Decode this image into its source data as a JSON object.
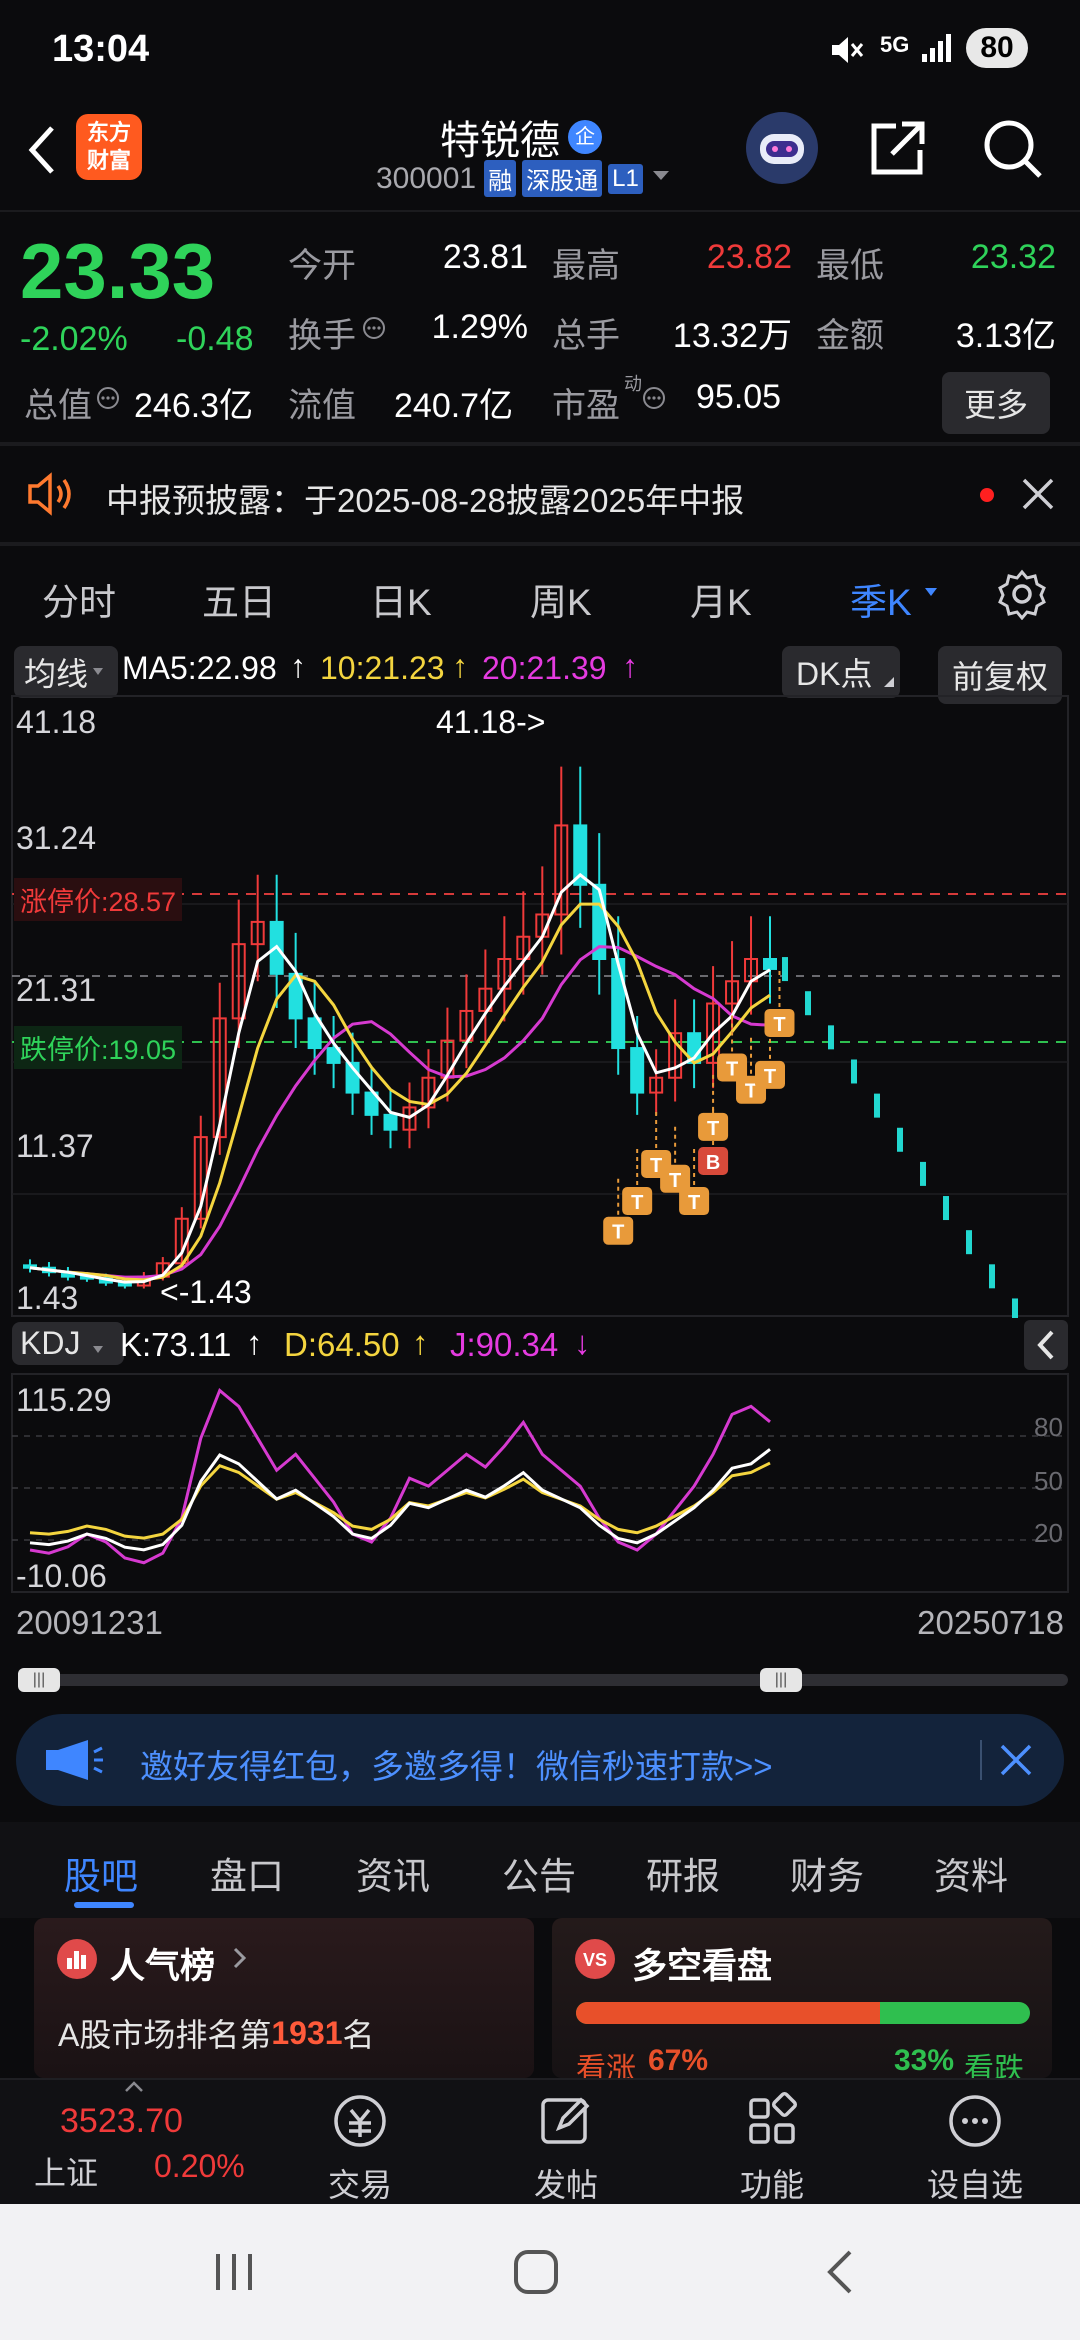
{
  "status_bar": {
    "time": "13:04",
    "network": "5G",
    "battery": "80"
  },
  "header": {
    "app_logo_text": "东方\n财富",
    "stock_name": "特锐德",
    "stock_code": "300001",
    "tags": [
      "融",
      "深股通",
      "L1"
    ],
    "enterprise_badge": "企"
  },
  "quote": {
    "price": "23.33",
    "change_pct": "-2.02%",
    "change_amt": "-0.48",
    "open_label": "今开",
    "open": "23.81",
    "high_label": "最高",
    "high": "23.82",
    "low_label": "最低",
    "low": "23.32",
    "turnover_label": "换手",
    "turnover": "1.29%",
    "volume_label": "总手",
    "volume": "13.32万",
    "amount_label": "金额",
    "amount": "3.13亿",
    "total_mv_label": "总值",
    "total_mv": "246.3亿",
    "float_mv_label": "流值",
    "float_mv": "240.7亿",
    "pe_label": "市盈",
    "pe_sup": "动",
    "pe": "95.05",
    "more_label": "更多"
  },
  "notice": {
    "text": "中报预披露：于2025-08-28披露2025年中报"
  },
  "chart_tabs": {
    "items": [
      "分时",
      "五日",
      "日K",
      "周K",
      "月K",
      "季K"
    ],
    "active": "季K"
  },
  "ma_bar": {
    "selector": "均线",
    "ma5": "MA5:22.98",
    "ma10": "10:21.23",
    "ma20": "20:21.39",
    "dk_label": "DK点",
    "adjust_label": "前复权"
  },
  "price_axis": {
    "top": "41.18",
    "mid1": "31.24",
    "mid2": "21.31",
    "mid3": "11.37",
    "bottom": "1.43"
  },
  "limit_up_label": "涨停价:28.57",
  "limit_down_label": "跌停价:19.05",
  "max_marker": "41.18->",
  "min_marker": "<-1.43",
  "kdj_bar": {
    "selector": "KDJ",
    "k": "K:73.11",
    "d": "D:64.50",
    "j": "J:90.34"
  },
  "kdj_axis": {
    "top": "115.29",
    "bottom": "-10.06",
    "r80": "80",
    "r50": "50",
    "r20": "20"
  },
  "date_range": {
    "start": "20091231",
    "end": "20250718"
  },
  "promo": {
    "text": "邀好友得红包，多邀多得！微信秒速打款>>"
  },
  "section_tabs": {
    "items": [
      "股吧",
      "盘口",
      "资讯",
      "公告",
      "研报",
      "财务",
      "资料"
    ],
    "active": "股吧"
  },
  "popularity_card": {
    "title": "人气榜",
    "rank_prefix": "A股市场排名第",
    "rank": "1931",
    "rank_suffix": "名"
  },
  "bull_bear_card": {
    "title": "多空看盘",
    "up_label": "看涨",
    "up_pct": "67%",
    "down_pct": "33%",
    "down_label": "看跌"
  },
  "index_ticker": {
    "value": "3523.70",
    "name": "上证",
    "pct": "0.20%"
  },
  "bottom_nav": [
    "交易",
    "发帖",
    "功能",
    "设自选"
  ],
  "colors": {
    "up": "#f03a3a",
    "down": "#2fd35a",
    "accent": "#3f86ff",
    "brand": "#ff5a1f"
  },
  "chart_data": [
    {
      "type": "candlestick",
      "title": "特锐德 季K",
      "x_range": [
        "20091231",
        "20250718"
      ],
      "ylim": [
        1.43,
        41.18
      ],
      "yticks": [
        41.18,
        31.24,
        21.31,
        11.37,
        1.43
      ],
      "reference_lines": [
        {
          "name": "涨停价",
          "value": 28.57
        },
        {
          "name": "跌停价",
          "value": 19.05
        }
      ],
      "series": [
        {
          "name": "MA5",
          "last": 22.98
        },
        {
          "name": "MA10",
          "last": 21.23
        },
        {
          "name": "MA20",
          "last": 21.39
        }
      ],
      "close_series_approx": [
        3.2,
        2.9,
        2.6,
        2.5,
        2.2,
        2.0,
        2.6,
        3.5,
        6.5,
        12.0,
        20.0,
        25.0,
        26.5,
        23.0,
        20.0,
        18.0,
        17.0,
        15.0,
        13.5,
        12.5,
        14.0,
        16.0,
        18.5,
        20.5,
        22.0,
        24.0,
        25.5,
        27.0,
        33.0,
        29.0,
        24.0,
        18.0,
        15.0,
        16.0,
        19.0,
        17.0,
        21.0,
        22.5,
        24.0,
        23.33
      ]
    },
    {
      "type": "line",
      "title": "KDJ",
      "ylim": [
        -10.06,
        115.29
      ],
      "reference_lines": [
        80,
        50,
        20
      ],
      "series": [
        {
          "name": "K",
          "last": 73.11
        },
        {
          "name": "D",
          "last": 64.5
        },
        {
          "name": "J",
          "last": 90.34
        }
      ]
    }
  ]
}
